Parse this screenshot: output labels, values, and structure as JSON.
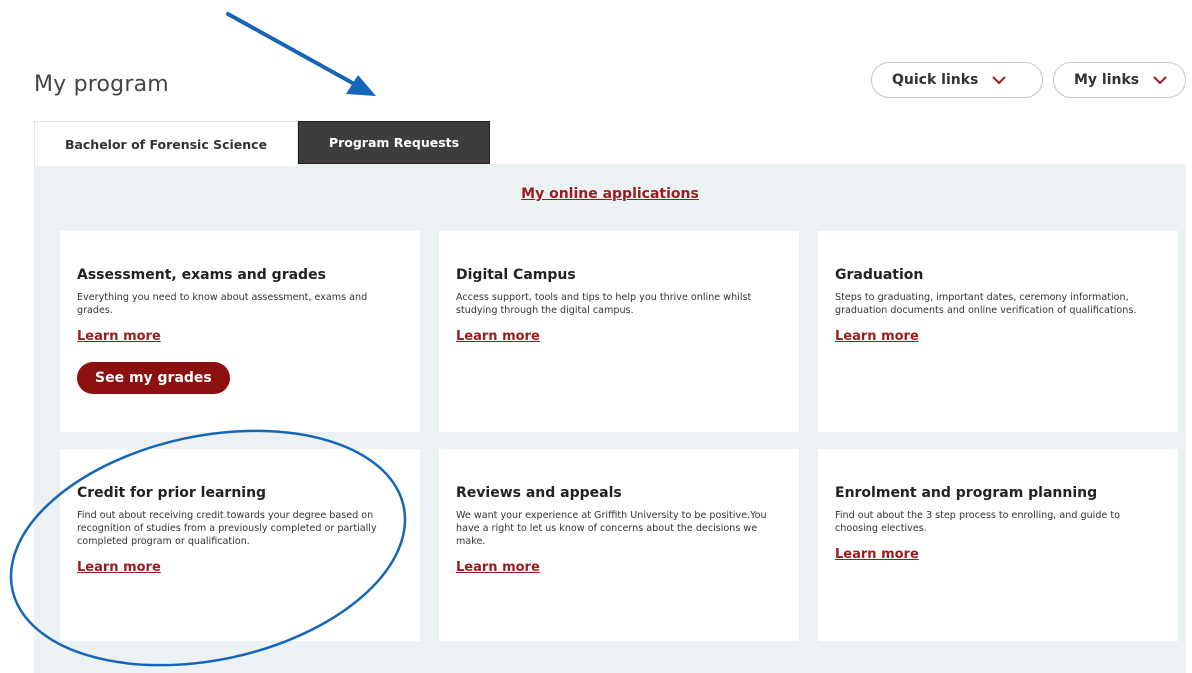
{
  "page": {
    "title": "My program"
  },
  "header_buttons": {
    "quick_links": "Quick links",
    "my_links": "My links"
  },
  "tabs": [
    {
      "label": "Bachelor of Forensic Science",
      "active": false
    },
    {
      "label": "Program Requests",
      "active": true
    }
  ],
  "applications_link": "My online applications",
  "cards": [
    {
      "title": "Assessment, exams and grades",
      "description": "Everything you need to know about assessment, exams and grades.",
      "link": "Learn more",
      "button": "See my grades"
    },
    {
      "title": "Digital Campus",
      "description": "Access support, tools and tips to help you thrive online whilst studying through the digital campus.",
      "link": "Learn more"
    },
    {
      "title": "Graduation",
      "description": "Steps to graduating, important dates, ceremony information, graduation documents and online verification of qualifications.",
      "link": "Learn more"
    },
    {
      "title": "Credit for prior learning",
      "description": "Find out about receiving credit towards your degree based on recognition of studies from a previously completed or partially completed program or qualification.",
      "link": "Learn more"
    },
    {
      "title": "Reviews and appeals",
      "description": "We want your experience at Griffith University to be positive.You have a right to let us know of concerns about the decisions we make.",
      "link": "Learn more"
    },
    {
      "title": "Enrolment and program planning",
      "description": "Find out about the 3 step process to enrolling, and guide to choosing electives.",
      "link": "Learn more"
    }
  ],
  "colors": {
    "brand_red": "#9a1d1d",
    "button_red": "#8c1010",
    "panel_bg": "#ecf1f3",
    "active_tab": "#3d3d3d",
    "annotation_blue": "#1565b8"
  },
  "annotations": {
    "arrow": "blue arrow pointing to Program Requests tab",
    "circle": "blue ellipse around Credit for prior learning card"
  }
}
